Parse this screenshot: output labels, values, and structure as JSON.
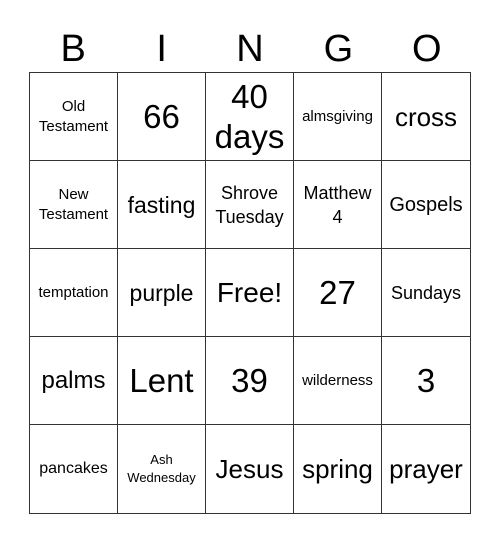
{
  "header": [
    "B",
    "I",
    "N",
    "G",
    "O"
  ],
  "cells": [
    "Old Testament",
    "66",
    "40 days",
    "almsgiving",
    "cross",
    "New Testament",
    "fasting",
    "Shrove Tuesday",
    "Matthew 4",
    "Gospels",
    "temptation",
    "purple",
    "Free!",
    "27",
    "Sundays",
    "palms",
    "Lent",
    "39",
    "wilderness",
    "3",
    "pancakes",
    "Ash Wednesday",
    "Jesus",
    "spring",
    "prayer"
  ]
}
